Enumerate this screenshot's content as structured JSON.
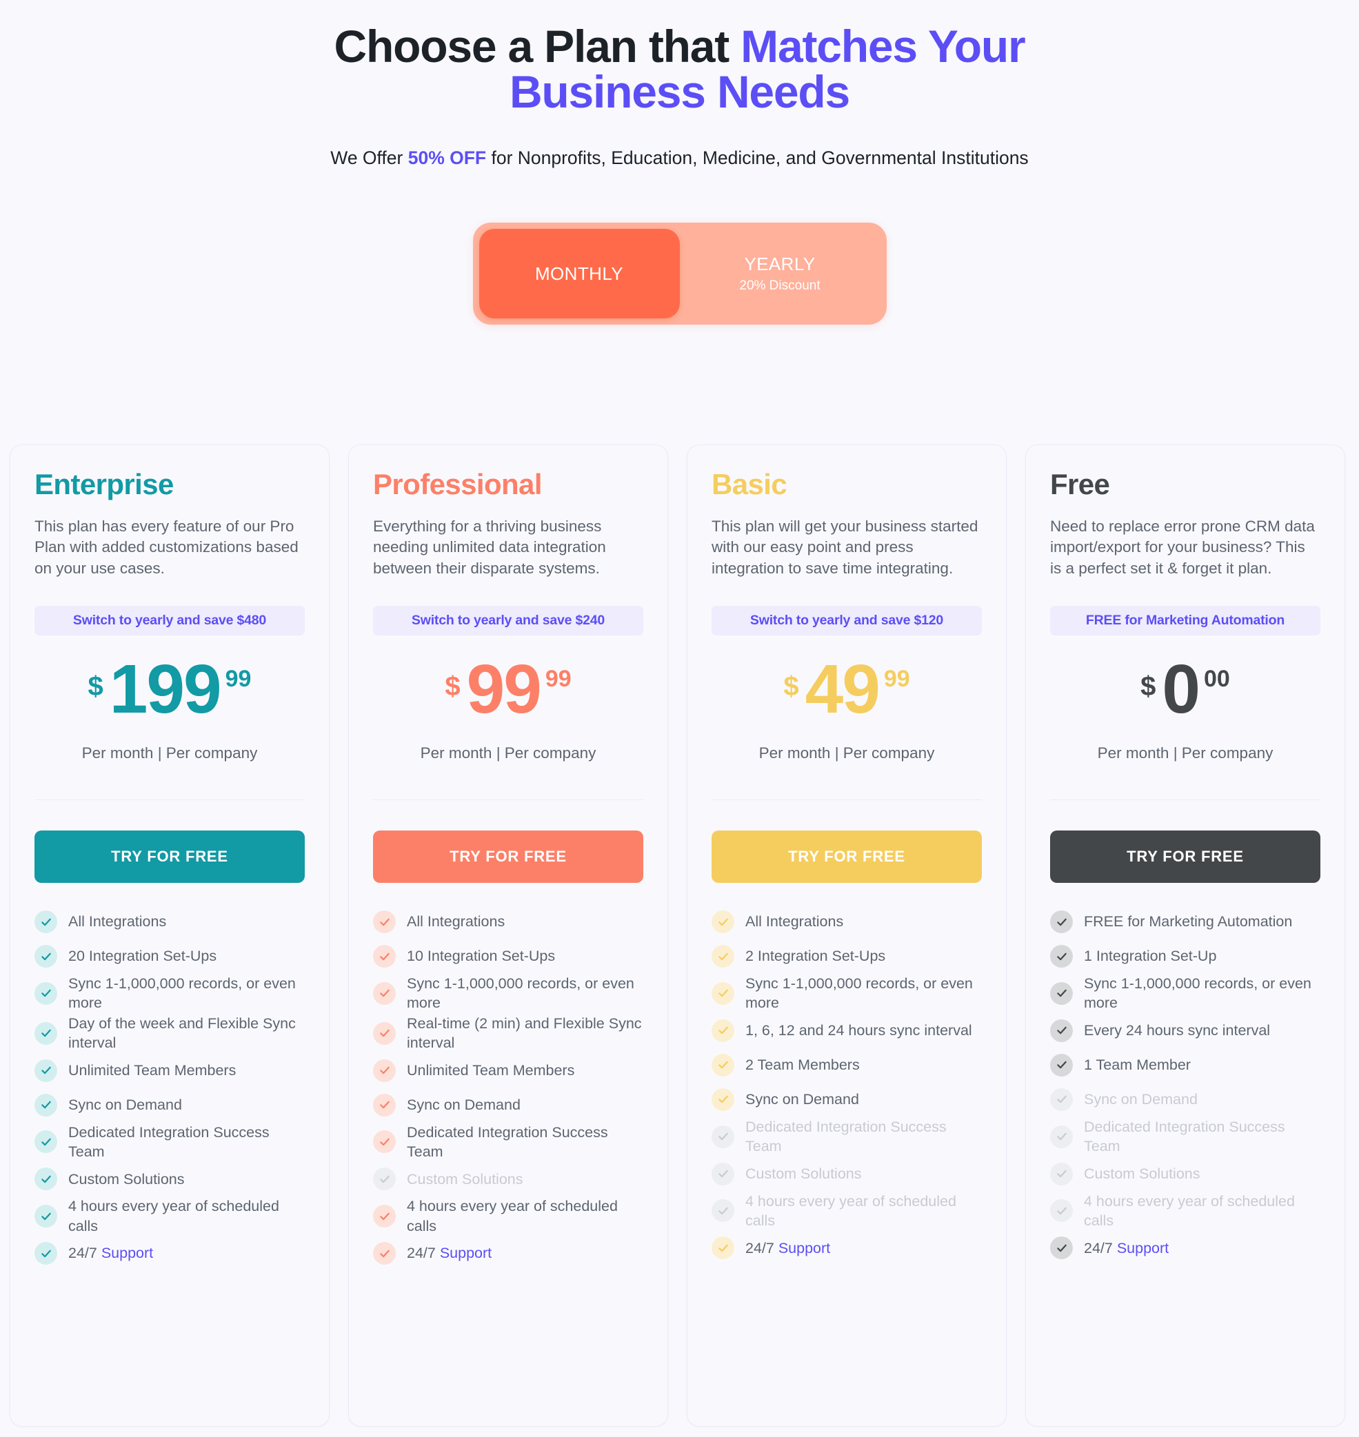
{
  "header": {
    "title_part1": "Choose a Plan that ",
    "title_accent1": "Matches Your",
    "title_accent2": "Business Needs",
    "sub_before": "We Offer ",
    "sub_accent": "50% OFF",
    "sub_after": " for Nonprofits, Education, Medicine, and Governmental Institutions"
  },
  "billing_toggle": {
    "monthly_label": "MONTHLY",
    "yearly_label": "YEARLY",
    "yearly_sub": "20% Discount",
    "active": "MONTHLY",
    "active_color": "#ff6b4a",
    "track_color": "#ffb19b"
  },
  "plans": [
    {
      "name": "Enterprise",
      "color": "#129aa5",
      "tick_bg": "#d3eeee",
      "tick_color": "#129aa5",
      "description": "This plan has every feature of our Pro Plan with added customizations based on your use cases.",
      "save_pill": "Switch to yearly and save $480",
      "currency": "$",
      "price_int": "199",
      "price_dec": "99",
      "price_note": "Per month | Per company",
      "cta_label": "TRY FOR FREE",
      "cta_bg": "#129aa5",
      "features": [
        {
          "text": "All Integrations",
          "enabled": true
        },
        {
          "text": "20 Integration Set-Ups",
          "enabled": true
        },
        {
          "text": "Sync 1-1,000,000 records, or even more",
          "enabled": true
        },
        {
          "text": "Day of the week and Flexible Sync interval",
          "enabled": true
        },
        {
          "text": "Unlimited Team Members",
          "enabled": true
        },
        {
          "text": "Sync on Demand",
          "enabled": true
        },
        {
          "text": "Dedicated Integration Success Team",
          "enabled": true
        },
        {
          "text": "Custom Solutions",
          "enabled": true
        },
        {
          "text": "4 hours every year of scheduled calls",
          "enabled": true
        },
        {
          "text": "24/7 ",
          "link_text": "Support",
          "enabled": true
        }
      ]
    },
    {
      "name": "Professional",
      "color": "#fc8068",
      "tick_bg": "#fde0d8",
      "tick_color": "#fc8068",
      "description": "Everything for a thriving business needing unlimited data integration between their disparate systems.",
      "save_pill": "Switch to yearly and save $240",
      "currency": "$",
      "price_int": "99",
      "price_dec": "99",
      "price_note": "Per month | Per company",
      "cta_label": "TRY FOR FREE",
      "cta_bg": "#fc8068",
      "features": [
        {
          "text": "All Integrations",
          "enabled": true
        },
        {
          "text": "10 Integration Set-Ups",
          "enabled": true
        },
        {
          "text": "Sync 1-1,000,000 records, or even more",
          "enabled": true
        },
        {
          "text": "Real-time (2 min) and Flexible Sync interval",
          "enabled": true
        },
        {
          "text": "Unlimited Team Members",
          "enabled": true
        },
        {
          "text": "Sync on Demand",
          "enabled": true
        },
        {
          "text": "Dedicated Integration Success Team",
          "enabled": true
        },
        {
          "text": "Custom Solutions",
          "enabled": false
        },
        {
          "text": "4 hours every year of scheduled calls",
          "enabled": true
        },
        {
          "text": "24/7 ",
          "link_text": "Support",
          "enabled": true
        }
      ]
    },
    {
      "name": "Basic",
      "color": "#f5cd5f",
      "tick_bg": "#fcefd0",
      "tick_color": "#f5cd5f",
      "description": "This plan will get your business started with our easy point and press integration to save time integrating.",
      "save_pill": "Switch to yearly and save $120",
      "currency": "$",
      "price_int": "49",
      "price_dec": "99",
      "price_note": "Per month | Per company",
      "cta_label": "TRY FOR FREE",
      "cta_bg": "#f5cd5f",
      "features": [
        {
          "text": "All Integrations",
          "enabled": true
        },
        {
          "text": "2 Integration Set-Ups",
          "enabled": true
        },
        {
          "text": "Sync 1-1,000,000 records, or even more",
          "enabled": true
        },
        {
          "text": "1, 6, 12 and 24 hours sync interval",
          "enabled": true
        },
        {
          "text": "2 Team Members",
          "enabled": true
        },
        {
          "text": "Sync on Demand",
          "enabled": true
        },
        {
          "text": "Dedicated Integration Success Team",
          "enabled": false
        },
        {
          "text": "Custom Solutions",
          "enabled": false
        },
        {
          "text": "4 hours every year of scheduled calls",
          "enabled": false
        },
        {
          "text": "24/7 ",
          "link_text": "Support",
          "enabled": true
        }
      ]
    },
    {
      "name": "Free",
      "color": "#44474a",
      "tick_bg": "#d7d8da",
      "tick_color": "#44474a",
      "description": "Need to replace error prone CRM data import/export for your business? This is a perfect set it & forget it plan.",
      "save_pill": "FREE for Marketing Automation",
      "currency": "$",
      "price_int": "0",
      "price_dec": "00",
      "price_note": "Per month | Per company",
      "cta_label": "TRY FOR FREE",
      "cta_bg": "#44474a",
      "features": [
        {
          "text": "FREE for Marketing Automation",
          "enabled": true
        },
        {
          "text": "1 Integration Set-Up",
          "enabled": true
        },
        {
          "text": "Sync 1-1,000,000 records, or even more",
          "enabled": true
        },
        {
          "text": "Every 24 hours sync interval",
          "enabled": true
        },
        {
          "text": "1 Team Member",
          "enabled": true
        },
        {
          "text": "Sync on Demand",
          "enabled": false
        },
        {
          "text": "Dedicated Integration Success Team",
          "enabled": false
        },
        {
          "text": "Custom Solutions",
          "enabled": false
        },
        {
          "text": "4 hours every year of scheduled calls",
          "enabled": false
        },
        {
          "text": "24/7 ",
          "link_text": "Support",
          "enabled": true
        }
      ]
    }
  ]
}
